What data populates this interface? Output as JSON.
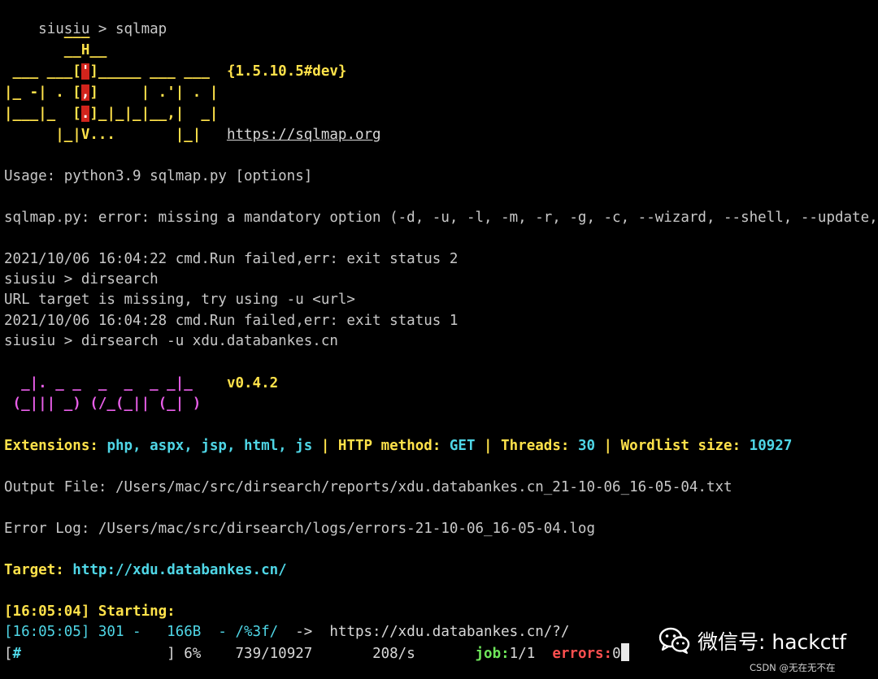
{
  "terminal": {
    "line1": "siusiu > sqlmap",
    "banner": {
      "b1": "       ___",
      "b2a": "       __H__",
      "b3a": " ___ ___[",
      "b3box": "'",
      "b3b": "]_____ ___ ___  ",
      "version": "{1.5.10.5#dev}",
      "b4a": "|_ -| . [",
      "b4box": ",",
      "b4b": "]     | .'| . |",
      "b5a": "|___|_  [",
      "b5box": ".",
      "b5b": "]_|_|_|__,|  _|",
      "b6a": "      |_|V...       |_|   ",
      "url": "https://sqlmap.org"
    },
    "usage": "Usage: python3.9 sqlmap.py [options]",
    "sqlmap_error": "sqlmap.py: error: missing a mandatory option (-d, -u, -l, -m, -r, -g, -c, --wizard, --shell, --update,",
    "cmd_fail_1": "2021/10/06 16:04:22 cmd.Run failed,err: exit status 2",
    "line_dirsearch": "siusiu > dirsearch",
    "url_missing": "URL target is missing, try using -u <url>",
    "cmd_fail_2": "2021/10/06 16:04:28 cmd.Run failed,err: exit status 1",
    "line_dirsearch_u": "siusiu > dirsearch -u xdu.databankes.cn",
    "ds_banner": {
      "l1": "  _|. _ _  _  _  _ _|_    ",
      "version": "v0.4.2",
      "l2": " (_||| _) (/_(_|| (_| )"
    },
    "config": {
      "ext_label": "Extensions: ",
      "ext_value": "php, aspx, jsp, html, js",
      "sep": " | ",
      "method_label": "HTTP method: ",
      "method_value": "GET",
      "threads_label": "Threads: ",
      "threads_value": "30",
      "wordlist_label": "Wordlist size: ",
      "wordlist_value": "10927"
    },
    "output_file": "Output File: /Users/mac/src/dirsearch/reports/xdu.databankes.cn_21-10-06_16-05-04.txt",
    "error_log": "Error Log: /Users/mac/src/dirsearch/logs/errors-21-10-06_16-05-04.log",
    "target_label": "Target: ",
    "target_value": "http://xdu.databankes.cn/",
    "starting": "[16:05:04] Starting:",
    "result_row": {
      "prefix": "[16:05:05] 301 -   166B  - /%3f/",
      "redirect": "  ->  https://xdu.databankes.cn/?/"
    },
    "progress": {
      "open": "[",
      "bar": "#",
      "rest": "                 ] 6%    739/10927       208/s       ",
      "job_label": "job:",
      "job_value": "1/1",
      "errors_label": "  errors:",
      "errors_value": "0",
      "fraction": 0.06
    }
  },
  "watermark": {
    "wechat": "微信号: hackctf",
    "csdn": "CSDN @无在无不在",
    "icon": "wechat-icon"
  },
  "colors": {
    "background": "#000000",
    "yellow": "#ffe24a",
    "cyan": "#4fd6e6",
    "magenta": "#e85ee8",
    "green": "#6ee65a",
    "red": "#ff5050",
    "sqlmap_red_box": "#d2241c"
  }
}
